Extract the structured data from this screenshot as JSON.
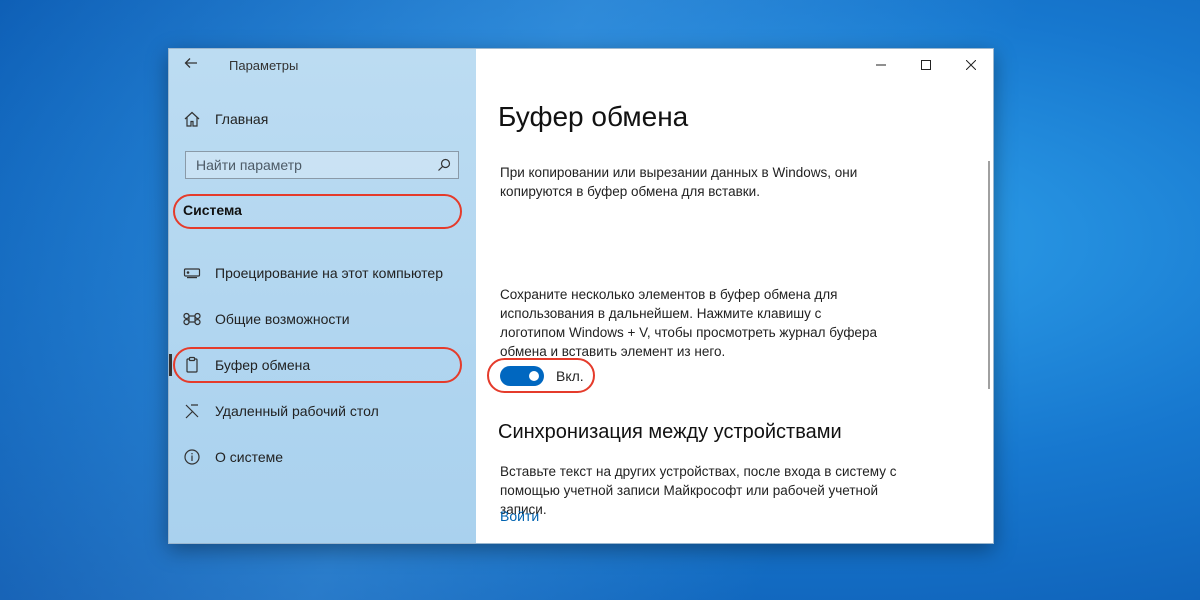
{
  "window": {
    "app_title": "Параметры",
    "controls": {
      "minimize": "minimize-icon",
      "maximize": "maximize-icon",
      "close": "close-icon"
    }
  },
  "sidebar": {
    "home_label": "Главная",
    "search_placeholder": "Найти параметр",
    "section_title": "Система",
    "items": [
      {
        "label": "Проецирование на этот компьютер",
        "icon": "projector-icon"
      },
      {
        "label": "Общие возможности",
        "icon": "shared-experiences-icon"
      },
      {
        "label": "Буфер обмена",
        "icon": "clipboard-icon",
        "selected": true
      },
      {
        "label": "Удаленный рабочий стол",
        "icon": "remote-desktop-icon"
      },
      {
        "label": "О системе",
        "icon": "info-icon"
      }
    ]
  },
  "main": {
    "title": "Буфер обмена",
    "intro": "При копировании или вырезании данных в Windows, они копируются в буфер обмена для вставки.",
    "history_text": "Сохраните несколько элементов в буфер обмена для использования в дальнейшем. Нажмите клавишу с логотипом Windows + V, чтобы просмотреть журнал буфера обмена и вставить элемент из него.",
    "toggle_label": "Вкл.",
    "toggle_on": true,
    "sync_title": "Синхронизация между устройствами",
    "sync_text": "Вставьте текст на других устройствах, после входа в систему с помощью учетной записи Майкрософт или рабочей учетной записи.",
    "sign_in_link": "Войти"
  },
  "colors": {
    "accent": "#0067c0",
    "highlight_ring": "#e53b2b",
    "sidebar_bg": "#b3d7f0"
  }
}
